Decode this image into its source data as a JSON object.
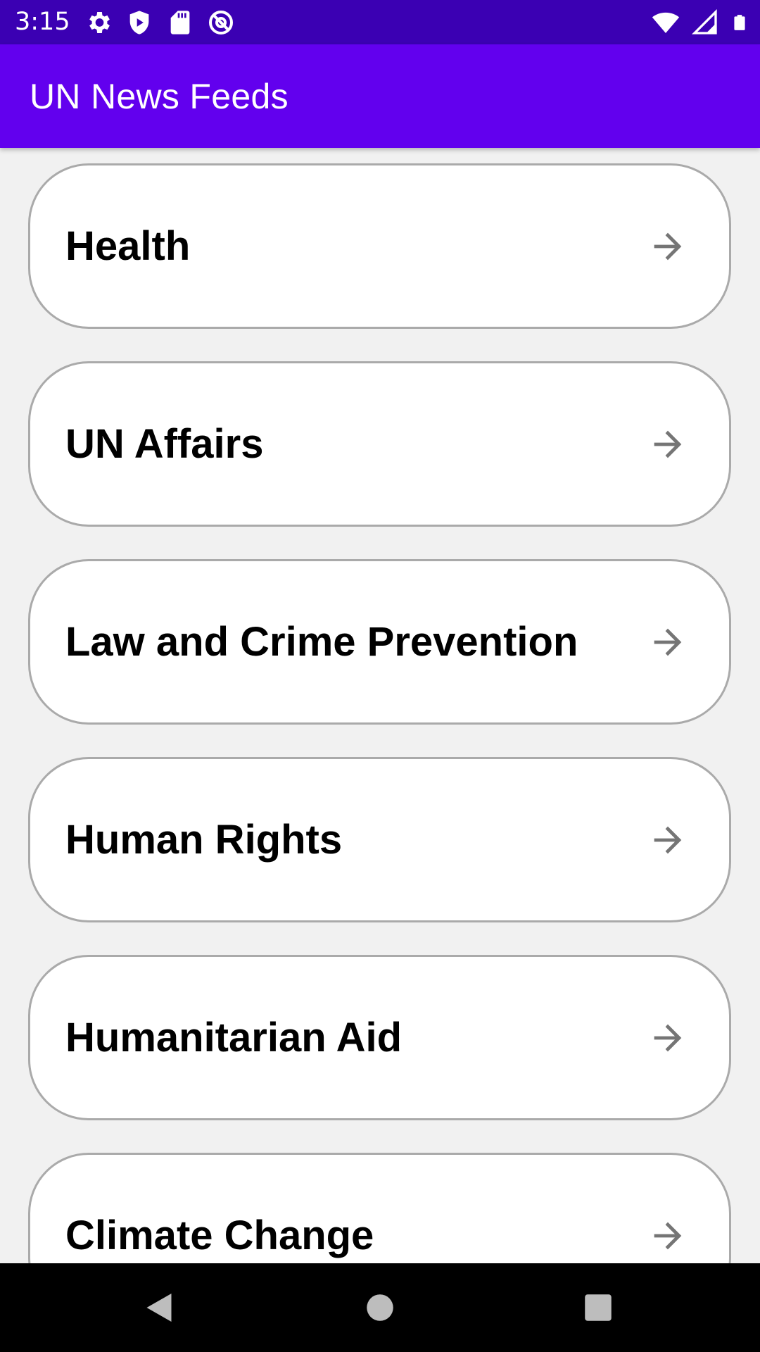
{
  "status_bar": {
    "time": "3:15",
    "left_icons": [
      "settings-icon",
      "shield-play-icon",
      "sd-card-icon",
      "at-sign-icon"
    ],
    "right_icons": [
      "wifi-icon",
      "signal-icon",
      "battery-icon"
    ]
  },
  "app_bar": {
    "title": "UN News Feeds",
    "color": "#6200ee"
  },
  "feeds": [
    {
      "label": "Health",
      "icon": "arrow-right-icon"
    },
    {
      "label": "UN Affairs",
      "icon": "arrow-right-icon"
    },
    {
      "label": "Law and Crime Prevention",
      "icon": "arrow-right-icon"
    },
    {
      "label": "Human Rights",
      "icon": "arrow-right-icon"
    },
    {
      "label": "Humanitarian Aid",
      "icon": "arrow-right-icon"
    },
    {
      "label": "Climate Change",
      "icon": "arrow-right-icon"
    }
  ],
  "nav_bar": {
    "buttons": [
      "back-icon",
      "home-icon",
      "recents-icon"
    ]
  },
  "colors": {
    "status_bar": "#3b00b3",
    "background": "#f1f1f1",
    "card_border": "#aaaaaa",
    "arrow": "#757575"
  }
}
